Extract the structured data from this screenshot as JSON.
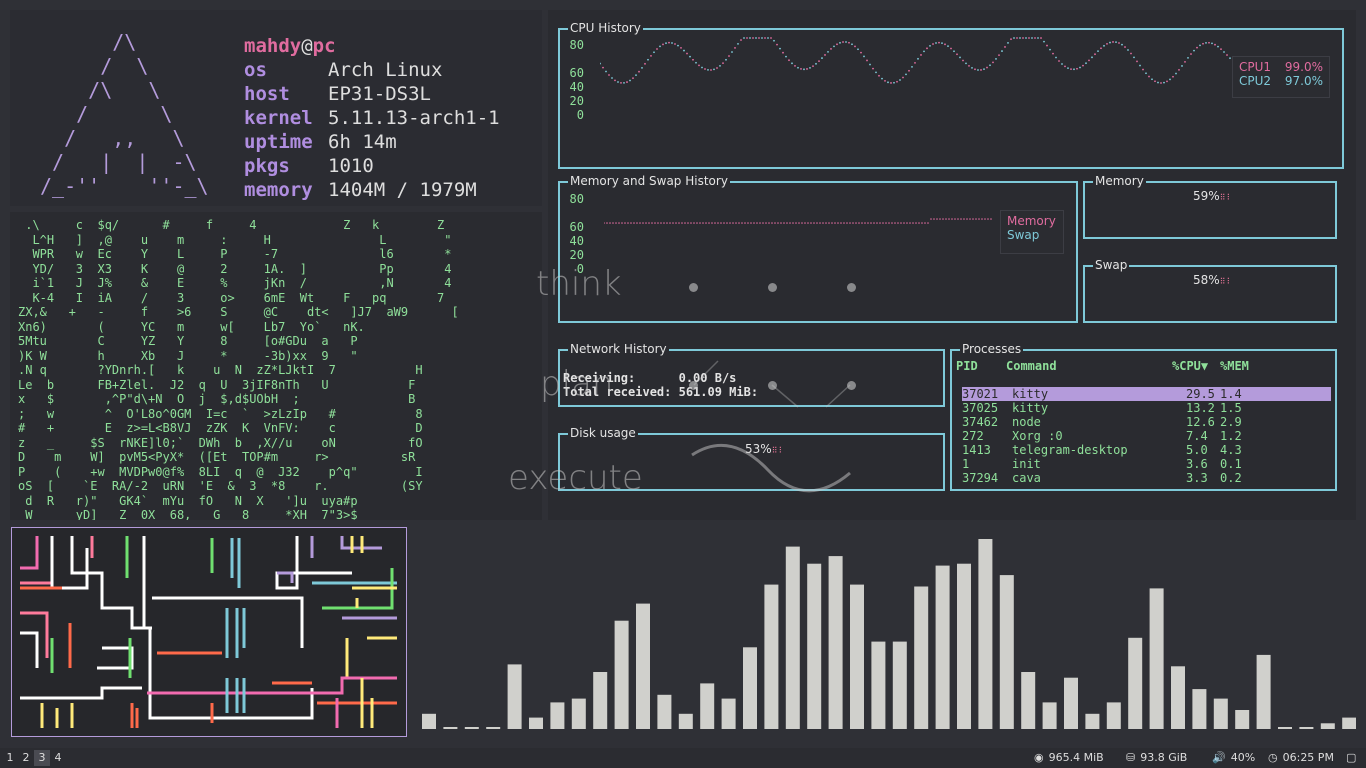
{
  "fetch": {
    "ascii": "      /\\\n     /  \\\n    /\\   \\\n   /      \\\n  /   ,,   \\\n /   |  |  -\\\n/_-''    ''-_\\",
    "user": "mahdy",
    "at": "@",
    "host": "pc",
    "rows": [
      {
        "key": "os",
        "value": "Arch Linux"
      },
      {
        "key": "host",
        "value": "EP31-DS3L"
      },
      {
        "key": "kernel",
        "value": "5.11.13-arch1-1"
      },
      {
        "key": "uptime",
        "value": "6h 14m"
      },
      {
        "key": "pkgs",
        "value": "1010"
      },
      {
        "key": "memory",
        "value": "1404M / 1979M"
      }
    ]
  },
  "matrix": {
    "text": " .\\     c  $q/      #     f     4            Z   k        Z\n  L^H   ]  ,@    u    m     :     H               L        \"\n  WPR   w  Ec    Y    L     P     -7              l6       *\n  YD/   3  X3    K    @     2     1A.  ]          Pp       4\n  i`1   J  J%    &    E     %     jKn  /          ,N       4\n  K-4   I  iA    /    3     o>    6mE  Wt    F   pq       7\nZX,&   +   -     f    >6    S     @C    dt<   ]J7  aW9      [\nXn6)       (     YC   m     w[    Lb7  Yo`   nK.\n5Mtu       C     YZ   Y     8     [o#GDu  a   P\n)K W       h     Xb   J     *     -3b)xx  9   \"\n.N q       ?YDnrh.[   k    u  N  zZ*LJktI  7           H\nLe  b      FB+Zlel.  J2  q  U  3jIF8nTh   U           F\nx   $       ,^P\"d\\+N  O  j  $,d$UObH  ;               B\n;   w       ^  O'L8o^0GM  I=c  `  >zLzIp   #           8\n#   +       E  z>=L<B8VJ  zZK  K  VnFV:    c           D\nz   _     $S  rNKE]l0;`  DWh  b  ,X//u    oN          fO\nD    m    W]  pvM5<PyX*  ([Et  TOP#m     r>          sR\nP    (    +w  MVDPw0@f%  8LI  q  @  J32    p^q\"        I\noS  [    `E  RA/-2  uRN  'E  &  3  *8    r.          (SY\n d  R   r)\"   GK4`  mYu  fO   N  X   ']u  uya#p\n W      yD]   Z  0X  68,   G   8  _  *XH  7\"3>$"
  },
  "cpu": {
    "title": "CPU History",
    "axis": [
      "80",
      "60",
      "40",
      "20",
      "0"
    ],
    "legend": [
      {
        "name": "CPU1",
        "value": "99.0%",
        "color": "#e06c9f"
      },
      {
        "name": "CPU2",
        "value": "97.0%",
        "color": "#7ec9d8"
      }
    ]
  },
  "memswap": {
    "title": "Memory and Swap History",
    "axis": [
      "80",
      "60",
      "40",
      "20",
      "0"
    ],
    "legend": [
      {
        "name": "Memory",
        "color": "#e06c9f"
      },
      {
        "name": "Swap",
        "color": "#7ec9d8"
      }
    ]
  },
  "memory": {
    "title": "Memory",
    "percent": "59%",
    "value": 59
  },
  "swap": {
    "title": "Swap",
    "percent": "58%",
    "value": 58
  },
  "network": {
    "title": "Network History",
    "receiving_label": "Receiving:",
    "receiving_value": "0.00 B/s",
    "total_label": "Total received:",
    "total_value": "561.09 MiB:"
  },
  "disk": {
    "title": "Disk usage",
    "percent": "53%",
    "value": 53
  },
  "processes": {
    "title": "Processes",
    "headers": {
      "pid": "PID",
      "command": "Command",
      "cpu": "%CPU▼",
      "mem": "%MEM"
    },
    "rows": [
      {
        "pid": "37021",
        "command": "kitty",
        "cpu": "29.5",
        "mem": "1.4"
      },
      {
        "pid": "37025",
        "command": "kitty",
        "cpu": "13.2",
        "mem": "1.5"
      },
      {
        "pid": "37462",
        "command": "node",
        "cpu": "12.6",
        "mem": "2.9"
      },
      {
        "pid": "272",
        "command": "Xorg :0",
        "cpu": "7.4",
        "mem": "1.2"
      },
      {
        "pid": "1413",
        "command": "telegram-desktop",
        "cpu": "5.0",
        "mem": "4.3"
      },
      {
        "pid": "1",
        "command": "init",
        "cpu": "3.6",
        "mem": "0.1"
      },
      {
        "pid": "37294",
        "command": "cava",
        "cpu": "3.3",
        "mem": "0.2"
      }
    ]
  },
  "watermark": {
    "think": "think",
    "plan": "plan",
    "execute": "execute"
  },
  "visualizer": {
    "bars": [
      0.08,
      0.01,
      0.01,
      0.01,
      0.34,
      0.06,
      0.14,
      0.16,
      0.3,
      0.57,
      0.66,
      0.18,
      0.08,
      0.24,
      0.16,
      0.43,
      0.76,
      0.96,
      0.87,
      0.91,
      0.76,
      0.46,
      0.46,
      0.75,
      0.86,
      0.87,
      1.0,
      0.81,
      0.3,
      0.14,
      0.27,
      0.08,
      0.14,
      0.48,
      0.74,
      0.33,
      0.21,
      0.16,
      0.1,
      0.39,
      0.01,
      0.01,
      0.03,
      0.06
    ],
    "color": "#d0d0cc"
  },
  "taskbar": {
    "workspaces": [
      "1",
      "2",
      "3",
      "4"
    ],
    "active_workspace": "3",
    "memory": "965.4 MiB",
    "disk": "93.8 GiB",
    "volume": "40%",
    "time": "06:25 PM"
  }
}
